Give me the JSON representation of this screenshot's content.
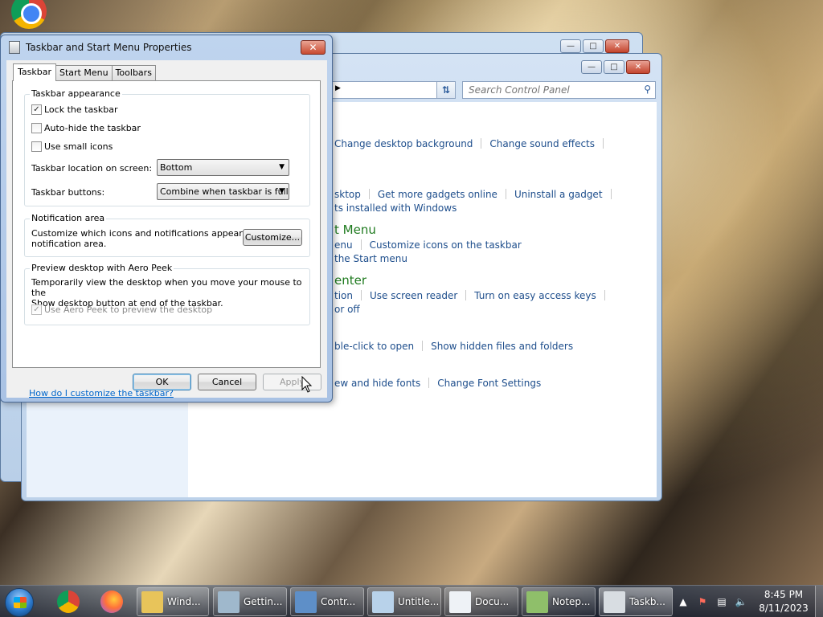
{
  "desktop": {
    "icon": "chrome-icon"
  },
  "control_panel": {
    "search_placeholder": "Search Control Panel",
    "rows": [
      {
        "items": [
          "Change desktop background",
          "Change sound effects"
        ]
      },
      {
        "items": [
          "sktop",
          "Get more gadgets online",
          "Uninstall a gadget"
        ]
      },
      {
        "items": [
          "ts installed with Windows"
        ]
      },
      {
        "heading": "t Menu"
      },
      {
        "items": [
          "enu",
          "Customize icons on the taskbar"
        ]
      },
      {
        "items": [
          "the Start menu"
        ]
      },
      {
        "heading": "enter"
      },
      {
        "items": [
          "tion",
          "Use screen reader",
          "Turn on easy access keys"
        ]
      },
      {
        "items": [
          "or off"
        ]
      },
      {
        "items": [
          "ble-click to open",
          "Show hidden files and folders"
        ]
      },
      {
        "items": [
          "ew and hide fonts",
          "Change Font Settings"
        ]
      }
    ]
  },
  "dialog": {
    "title": "Taskbar and Start Menu Properties",
    "tabs": [
      "Taskbar",
      "Start Menu",
      "Toolbars"
    ],
    "appearance": {
      "title": "Taskbar appearance",
      "lock": {
        "label": "Lock the taskbar",
        "checked": true
      },
      "autohide": {
        "label": "Auto-hide the taskbar",
        "checked": false
      },
      "small_icons": {
        "label": "Use small icons",
        "checked": false
      },
      "location_label": "Taskbar location on screen:",
      "location_value": "Bottom",
      "buttons_label": "Taskbar buttons:",
      "buttons_value": "Combine when taskbar is full"
    },
    "notification": {
      "title": "Notification area",
      "desc_line1": "Customize which icons and notifications appear in the",
      "desc_line2": "notification area.",
      "customize_label": "Customize..."
    },
    "aero": {
      "title": "Preview desktop with Aero Peek",
      "desc_line1": "Temporarily view the desktop when you move your mouse to the",
      "desc_line2": "Show desktop button at end of the taskbar.",
      "checkbox_label": "Use Aero Peek to preview the desktop",
      "checked": true,
      "disabled": true
    },
    "help_link": "How do I customize the taskbar?",
    "buttons": {
      "ok": "OK",
      "cancel": "Cancel",
      "apply": "Apply"
    }
  },
  "taskbar": {
    "pinned": [
      "chrome-icon",
      "firefox-icon"
    ],
    "tasks": [
      {
        "label": "Wind...",
        "icon": "folder-icon",
        "color": "#e8c45a"
      },
      {
        "label": "Gettin...",
        "icon": "getting-started-icon",
        "color": "#9fb8cc"
      },
      {
        "label": "Contr...",
        "icon": "control-panel-icon",
        "color": "#5e8fc8"
      },
      {
        "label": "Untitle...",
        "icon": "paint-icon",
        "color": "#b8d2ea"
      },
      {
        "label": "Docu...",
        "icon": "wordpad-icon",
        "color": "#eef2f6"
      },
      {
        "label": "Notep...",
        "icon": "notepad-icon",
        "color": "#8fbf6a"
      },
      {
        "label": "Taskb...",
        "icon": "taskbar-properties-icon",
        "color": "#d8dde2"
      }
    ],
    "clock_time": "8:45 PM",
    "clock_date": "8/11/2023"
  }
}
